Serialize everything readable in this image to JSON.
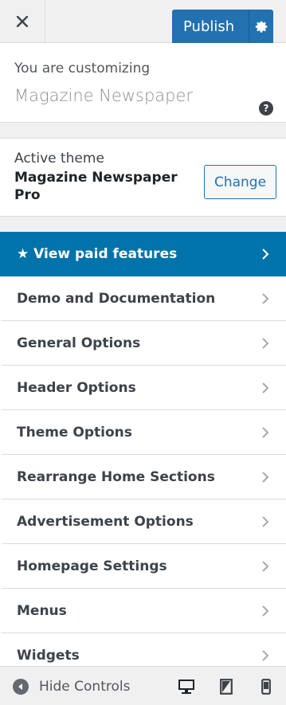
{
  "header": {
    "publish_label": "Publish"
  },
  "customizing": {
    "label": "You are customizing",
    "site_name": "Magazine Newspaper",
    "help_glyph": "?"
  },
  "active_theme": {
    "label": "Active theme",
    "name": "Magazine Newspaper Pro",
    "change_label": "Change"
  },
  "menu": {
    "items": [
      {
        "label": "★ View paid features",
        "featured": true
      },
      {
        "label": "Demo and Documentation"
      },
      {
        "label": "General Options"
      },
      {
        "label": "Header Options"
      },
      {
        "label": "Theme Options"
      },
      {
        "label": "Rearrange Home Sections"
      },
      {
        "label": "Advertisement Options"
      },
      {
        "label": "Homepage Settings"
      },
      {
        "label": "Menus"
      },
      {
        "label": "Widgets"
      }
    ]
  },
  "footer": {
    "hide_controls_label": "Hide Controls",
    "devices": [
      "desktop",
      "tablet",
      "mobile"
    ]
  },
  "colors": {
    "accent": "#2271b1",
    "featured": "#0073aa",
    "background": "#f0f0f1",
    "panel": "#ffffff"
  },
  "icons": [
    "close-icon",
    "gear-icon",
    "help-icon",
    "chevron-right-icon",
    "arrow-left-icon",
    "desktop-icon",
    "tablet-icon",
    "mobile-icon"
  ]
}
